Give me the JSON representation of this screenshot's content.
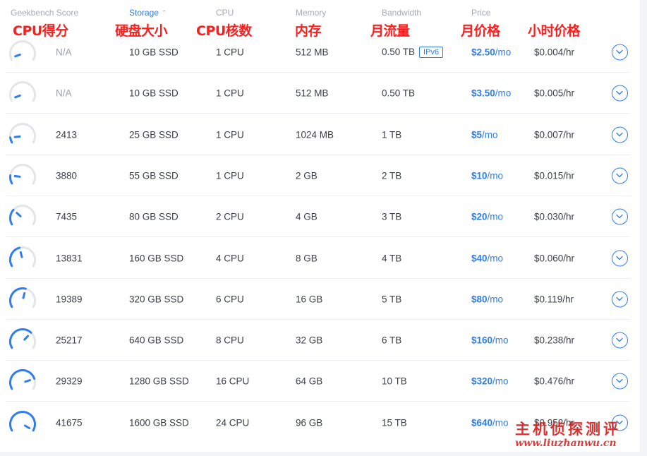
{
  "headers": {
    "score": "Geekbench Score",
    "storage": "Storage",
    "cpu": "CPU",
    "memory": "Memory",
    "bandwidth": "Bandwidth",
    "price": "Price"
  },
  "annotations": {
    "score": "CPU得分",
    "storage": "硬盘大小",
    "cpu": "CPU核数",
    "memory": "内存",
    "bandwidth": "月流量",
    "monthly": "月价格",
    "hourly": "小时价格"
  },
  "colors": {
    "accent": "#2e7ef0",
    "muted": "#a6abb3",
    "gauge_track": "#e3e5e8",
    "annotation": "#ff1e1e"
  },
  "plans": [
    {
      "score": "N/A",
      "gauge": 0.04,
      "storage": "10 GB SSD",
      "cpu": "1 CPU",
      "memory": "512 MB",
      "bandwidth": "0.50 TB",
      "tag": "IPv6",
      "price_num": "$2.50",
      "price_unit": "/mo",
      "hourly": "$0.004/hr"
    },
    {
      "score": "N/A",
      "gauge": 0.04,
      "storage": "10 GB SSD",
      "cpu": "1 CPU",
      "memory": "512 MB",
      "bandwidth": "0.50 TB",
      "tag": "",
      "price_num": "$3.50",
      "price_unit": "/mo",
      "hourly": "$0.005/hr"
    },
    {
      "score": "2413",
      "gauge": 0.1,
      "storage": "25 GB SSD",
      "cpu": "1 CPU",
      "memory": "1024 MB",
      "bandwidth": "1 TB",
      "tag": "",
      "price_num": "$5",
      "price_unit": "/mo",
      "hourly": "$0.007/hr"
    },
    {
      "score": "3880",
      "gauge": 0.16,
      "storage": "55 GB SSD",
      "cpu": "1 CPU",
      "memory": "2 GB",
      "bandwidth": "2 TB",
      "tag": "",
      "price_num": "$10",
      "price_unit": "/mo",
      "hourly": "$0.015/hr"
    },
    {
      "score": "7435",
      "gauge": 0.3,
      "storage": "80 GB SSD",
      "cpu": "2 CPU",
      "memory": "4 GB",
      "bandwidth": "3 TB",
      "tag": "",
      "price_num": "$20",
      "price_unit": "/mo",
      "hourly": "$0.030/hr"
    },
    {
      "score": "13831",
      "gauge": 0.44,
      "storage": "160 GB SSD",
      "cpu": "4 CPU",
      "memory": "8 GB",
      "bandwidth": "4 TB",
      "tag": "",
      "price_num": "$40",
      "price_unit": "/mo",
      "hourly": "$0.060/hr"
    },
    {
      "score": "19389",
      "gauge": 0.56,
      "storage": "320 GB SSD",
      "cpu": "6 CPU",
      "memory": "16 GB",
      "bandwidth": "5 TB",
      "tag": "",
      "price_num": "$80",
      "price_unit": "/mo",
      "hourly": "$0.119/hr"
    },
    {
      "score": "25217",
      "gauge": 0.68,
      "storage": "640 GB SSD",
      "cpu": "8 CPU",
      "memory": "32 GB",
      "bandwidth": "6 TB",
      "tag": "",
      "price_num": "$160",
      "price_unit": "/mo",
      "hourly": "$0.238/hr"
    },
    {
      "score": "29329",
      "gauge": 0.8,
      "storage": "1280 GB SSD",
      "cpu": "16 CPU",
      "memory": "64 GB",
      "bandwidth": "10 TB",
      "tag": "",
      "price_num": "$320",
      "price_unit": "/mo",
      "hourly": "$0.476/hr"
    },
    {
      "score": "41675",
      "gauge": 1.0,
      "storage": "1600 GB SSD",
      "cpu": "24 CPU",
      "memory": "96 GB",
      "bandwidth": "15 TB",
      "tag": "",
      "price_num": "$640",
      "price_unit": "/mo",
      "hourly": "$0.952/hr"
    }
  ],
  "watermark": {
    "chinese": "主机侦探测评",
    "url": "www.liuzhanwu.cn"
  }
}
